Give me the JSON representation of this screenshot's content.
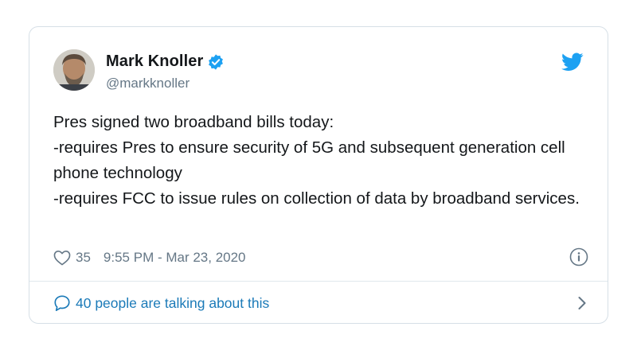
{
  "tweet": {
    "author_name": "Mark Knoller",
    "author_handle": "@markknoller",
    "verified": true,
    "text": "Pres signed two broadband bills today:\n-requires Pres to ensure security of 5G and subsequent generation cell phone technology\n-requires FCC to issue rules on collection of data by broadband services.",
    "likes": "35",
    "timestamp": "9:55 PM - Mar 23, 2020",
    "talking": "40 people are talking about this"
  },
  "colors": {
    "brand_blue": "#1da1f2",
    "link_blue": "#1b7ab8",
    "secondary_text": "#657786",
    "primary_text": "#14171a",
    "border": "#d6dfe6"
  },
  "icons": {
    "verified": "verified-badge-icon",
    "brand": "twitter-bird-icon",
    "like": "heart-outline-icon",
    "info": "info-circle-icon",
    "reply": "speech-bubble-icon",
    "chevron": "chevron-right-icon"
  }
}
